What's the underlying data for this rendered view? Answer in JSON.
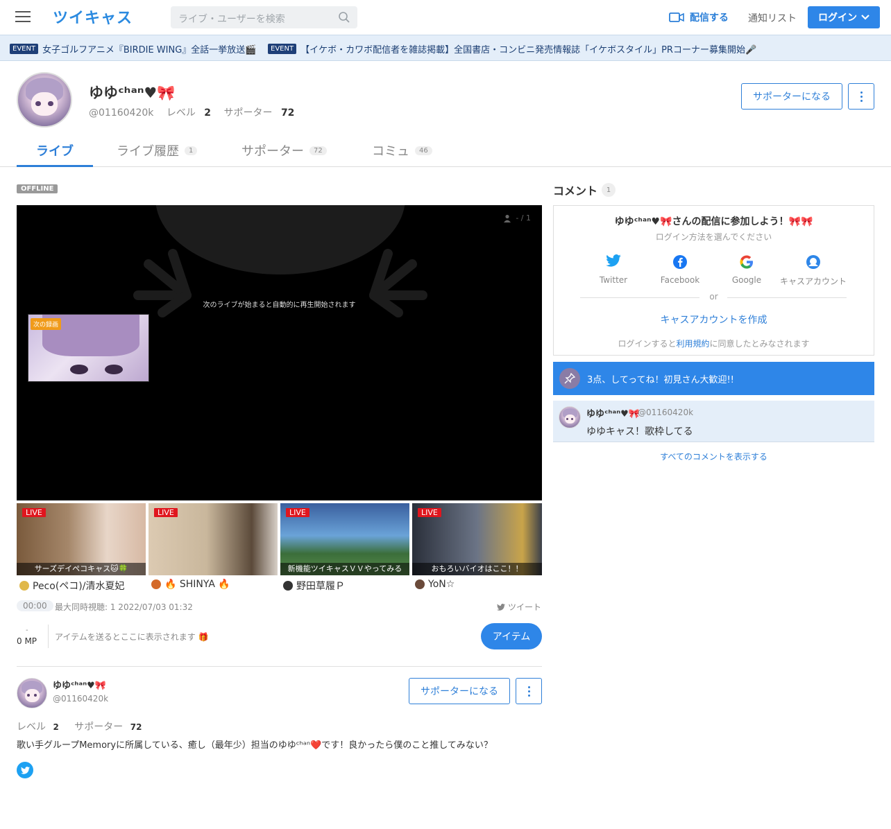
{
  "header": {
    "logo": "ツイキャス",
    "search_placeholder": "ライブ・ユーザーを検索",
    "broadcast_label": "配信する",
    "notif_label": "通知リスト",
    "login_label": "ログイン"
  },
  "events": [
    {
      "tag": "EVENT",
      "text": "女子ゴルフアニメ『BIRDIE WING』全話一挙放送🎬"
    },
    {
      "tag": "EVENT",
      "text": "【イケボ・カワボ配信者を雑誌掲載】全国書店・コンビニ発売情報誌「イケボスタイル」PRコーナー募集開始🎤"
    }
  ],
  "profile": {
    "name": "ゆゆᶜʰᵃⁿ♥︎🎀",
    "handle": "@01160420k",
    "level_label": "レベル",
    "level": "2",
    "supporter_label": "サポーター",
    "supporters": "72",
    "support_button": "サポーターになる"
  },
  "tabs": [
    {
      "label": "ライブ",
      "count": ""
    },
    {
      "label": "ライブ履歴",
      "count": "1"
    },
    {
      "label": "サポーター",
      "count": "72"
    },
    {
      "label": "コミュ",
      "count": "46"
    }
  ],
  "player": {
    "status": "OFFLINE",
    "viewer_text": "- / 1",
    "message": "次のライブが始まると自動的に再生開始されます",
    "next_label": "次の録画"
  },
  "live_cards": [
    {
      "tag": "LIVE",
      "caption": "サーズデイペコキャス🐱🍀",
      "user": "Peco(ペコ)/清水夏妃",
      "color_a": "#7a5a3c",
      "color_b": "#e8d6c8",
      "mini": "#e0b84a"
    },
    {
      "tag": "LIVE",
      "caption": "",
      "user": "🔥 SHINYA 🔥",
      "color_a": "#c9b79c",
      "color_b": "#5b4a3a",
      "mini": "#d46a2a"
    },
    {
      "tag": "LIVE",
      "caption": "新機能ツイキャスＶＶやってみる",
      "user": "野田草履Ｐ",
      "color_a": "#3a5f9e",
      "color_b": "#6aa3d8",
      "mini": "#333"
    },
    {
      "tag": "LIVE",
      "caption": "おもろいバイオはここ！！",
      "user": "YoN☆",
      "color_a": "#2a2f3a",
      "color_b": "#6b7486",
      "mini": "#6a4a3a"
    }
  ],
  "stats": {
    "time": "00:00",
    "info": "最大同時視聴: 1   2022/07/03 01:32",
    "tweet": "ツイート",
    "mp_dash": "-",
    "mp": "0 MP",
    "item_hint": "アイテムを送るとここに表示されます 🎁",
    "item_button": "アイテム"
  },
  "bottom_profile": {
    "name": "ゆゆᶜʰᵃⁿ♥︎🎀",
    "handle": "@01160420k",
    "level_label": "レベル",
    "level": "2",
    "supporter_label": "サポーター",
    "supporters": "72",
    "support_button": "サポーターになる",
    "description": "歌い手グループMemoryに所属している、癒し（最年少）担当のゆゆᶜʰᵃⁿ❤️です！良かったら僕のこと推してみない？"
  },
  "comments": {
    "title": "コメント",
    "count": "1",
    "join_title": "ゆゆᶜʰᵃⁿ♥︎🎀さんの配信に参加しよう！🎀🎀",
    "join_sub": "ログイン方法を選んでください",
    "sns": [
      "Twitter",
      "Facebook",
      "Google",
      "キャスアカウント"
    ],
    "or": "or",
    "create_account": "キャスアカウントを作成",
    "terms_pre": "ログインすると",
    "terms_link": "利用規約",
    "terms_post": "に同意したとみなされます",
    "pinned": "3点、してってね！初見さん大歓迎!!",
    "items": [
      {
        "name": "ゆゆᶜʰᵃⁿ♥︎🎀",
        "handle": "@01160420k",
        "text": "ゆゆキャス！歌枠してる"
      }
    ],
    "show_all": "すべてのコメントを表示する"
  },
  "colors": {
    "accent": "#2e86e8",
    "live": "#e0161e",
    "event_bg": "#e4eef9",
    "next_tag": "#f09b1a"
  }
}
